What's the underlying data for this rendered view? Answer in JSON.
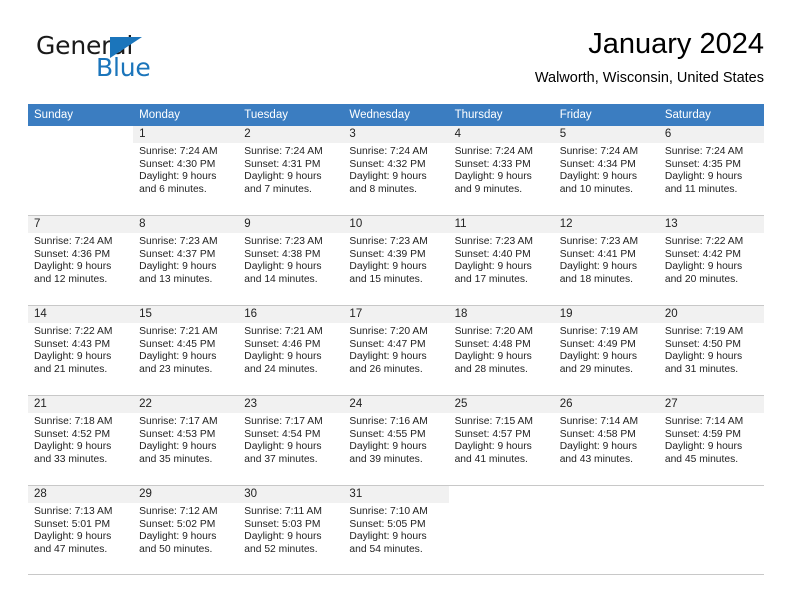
{
  "brand": {
    "name_top": "General",
    "name_bottom": "Blue",
    "accent_color": "#1b75bb"
  },
  "header": {
    "month_title": "January 2024",
    "location": "Walworth, Wisconsin, United States"
  },
  "calendar": {
    "header_color": "#3b7dc1",
    "weekday_headers": [
      "Sunday",
      "Monday",
      "Tuesday",
      "Wednesday",
      "Thursday",
      "Friday",
      "Saturday"
    ],
    "weeks": [
      [
        {
          "day": "",
          "sunrise": "",
          "sunset": "",
          "daylight_line1": "",
          "daylight_line2": ""
        },
        {
          "day": "1",
          "sunrise": "Sunrise: 7:24 AM",
          "sunset": "Sunset: 4:30 PM",
          "daylight_line1": "Daylight: 9 hours",
          "daylight_line2": "and 6 minutes."
        },
        {
          "day": "2",
          "sunrise": "Sunrise: 7:24 AM",
          "sunset": "Sunset: 4:31 PM",
          "daylight_line1": "Daylight: 9 hours",
          "daylight_line2": "and 7 minutes."
        },
        {
          "day": "3",
          "sunrise": "Sunrise: 7:24 AM",
          "sunset": "Sunset: 4:32 PM",
          "daylight_line1": "Daylight: 9 hours",
          "daylight_line2": "and 8 minutes."
        },
        {
          "day": "4",
          "sunrise": "Sunrise: 7:24 AM",
          "sunset": "Sunset: 4:33 PM",
          "daylight_line1": "Daylight: 9 hours",
          "daylight_line2": "and 9 minutes."
        },
        {
          "day": "5",
          "sunrise": "Sunrise: 7:24 AM",
          "sunset": "Sunset: 4:34 PM",
          "daylight_line1": "Daylight: 9 hours",
          "daylight_line2": "and 10 minutes."
        },
        {
          "day": "6",
          "sunrise": "Sunrise: 7:24 AM",
          "sunset": "Sunset: 4:35 PM",
          "daylight_line1": "Daylight: 9 hours",
          "daylight_line2": "and 11 minutes."
        }
      ],
      [
        {
          "day": "7",
          "sunrise": "Sunrise: 7:24 AM",
          "sunset": "Sunset: 4:36 PM",
          "daylight_line1": "Daylight: 9 hours",
          "daylight_line2": "and 12 minutes."
        },
        {
          "day": "8",
          "sunrise": "Sunrise: 7:23 AM",
          "sunset": "Sunset: 4:37 PM",
          "daylight_line1": "Daylight: 9 hours",
          "daylight_line2": "and 13 minutes."
        },
        {
          "day": "9",
          "sunrise": "Sunrise: 7:23 AM",
          "sunset": "Sunset: 4:38 PM",
          "daylight_line1": "Daylight: 9 hours",
          "daylight_line2": "and 14 minutes."
        },
        {
          "day": "10",
          "sunrise": "Sunrise: 7:23 AM",
          "sunset": "Sunset: 4:39 PM",
          "daylight_line1": "Daylight: 9 hours",
          "daylight_line2": "and 15 minutes."
        },
        {
          "day": "11",
          "sunrise": "Sunrise: 7:23 AM",
          "sunset": "Sunset: 4:40 PM",
          "daylight_line1": "Daylight: 9 hours",
          "daylight_line2": "and 17 minutes."
        },
        {
          "day": "12",
          "sunrise": "Sunrise: 7:23 AM",
          "sunset": "Sunset: 4:41 PM",
          "daylight_line1": "Daylight: 9 hours",
          "daylight_line2": "and 18 minutes."
        },
        {
          "day": "13",
          "sunrise": "Sunrise: 7:22 AM",
          "sunset": "Sunset: 4:42 PM",
          "daylight_line1": "Daylight: 9 hours",
          "daylight_line2": "and 20 minutes."
        }
      ],
      [
        {
          "day": "14",
          "sunrise": "Sunrise: 7:22 AM",
          "sunset": "Sunset: 4:43 PM",
          "daylight_line1": "Daylight: 9 hours",
          "daylight_line2": "and 21 minutes."
        },
        {
          "day": "15",
          "sunrise": "Sunrise: 7:21 AM",
          "sunset": "Sunset: 4:45 PM",
          "daylight_line1": "Daylight: 9 hours",
          "daylight_line2": "and 23 minutes."
        },
        {
          "day": "16",
          "sunrise": "Sunrise: 7:21 AM",
          "sunset": "Sunset: 4:46 PM",
          "daylight_line1": "Daylight: 9 hours",
          "daylight_line2": "and 24 minutes."
        },
        {
          "day": "17",
          "sunrise": "Sunrise: 7:20 AM",
          "sunset": "Sunset: 4:47 PM",
          "daylight_line1": "Daylight: 9 hours",
          "daylight_line2": "and 26 minutes."
        },
        {
          "day": "18",
          "sunrise": "Sunrise: 7:20 AM",
          "sunset": "Sunset: 4:48 PM",
          "daylight_line1": "Daylight: 9 hours",
          "daylight_line2": "and 28 minutes."
        },
        {
          "day": "19",
          "sunrise": "Sunrise: 7:19 AM",
          "sunset": "Sunset: 4:49 PM",
          "daylight_line1": "Daylight: 9 hours",
          "daylight_line2": "and 29 minutes."
        },
        {
          "day": "20",
          "sunrise": "Sunrise: 7:19 AM",
          "sunset": "Sunset: 4:50 PM",
          "daylight_line1": "Daylight: 9 hours",
          "daylight_line2": "and 31 minutes."
        }
      ],
      [
        {
          "day": "21",
          "sunrise": "Sunrise: 7:18 AM",
          "sunset": "Sunset: 4:52 PM",
          "daylight_line1": "Daylight: 9 hours",
          "daylight_line2": "and 33 minutes."
        },
        {
          "day": "22",
          "sunrise": "Sunrise: 7:17 AM",
          "sunset": "Sunset: 4:53 PM",
          "daylight_line1": "Daylight: 9 hours",
          "daylight_line2": "and 35 minutes."
        },
        {
          "day": "23",
          "sunrise": "Sunrise: 7:17 AM",
          "sunset": "Sunset: 4:54 PM",
          "daylight_line1": "Daylight: 9 hours",
          "daylight_line2": "and 37 minutes."
        },
        {
          "day": "24",
          "sunrise": "Sunrise: 7:16 AM",
          "sunset": "Sunset: 4:55 PM",
          "daylight_line1": "Daylight: 9 hours",
          "daylight_line2": "and 39 minutes."
        },
        {
          "day": "25",
          "sunrise": "Sunrise: 7:15 AM",
          "sunset": "Sunset: 4:57 PM",
          "daylight_line1": "Daylight: 9 hours",
          "daylight_line2": "and 41 minutes."
        },
        {
          "day": "26",
          "sunrise": "Sunrise: 7:14 AM",
          "sunset": "Sunset: 4:58 PM",
          "daylight_line1": "Daylight: 9 hours",
          "daylight_line2": "and 43 minutes."
        },
        {
          "day": "27",
          "sunrise": "Sunrise: 7:14 AM",
          "sunset": "Sunset: 4:59 PM",
          "daylight_line1": "Daylight: 9 hours",
          "daylight_line2": "and 45 minutes."
        }
      ],
      [
        {
          "day": "28",
          "sunrise": "Sunrise: 7:13 AM",
          "sunset": "Sunset: 5:01 PM",
          "daylight_line1": "Daylight: 9 hours",
          "daylight_line2": "and 47 minutes."
        },
        {
          "day": "29",
          "sunrise": "Sunrise: 7:12 AM",
          "sunset": "Sunset: 5:02 PM",
          "daylight_line1": "Daylight: 9 hours",
          "daylight_line2": "and 50 minutes."
        },
        {
          "day": "30",
          "sunrise": "Sunrise: 7:11 AM",
          "sunset": "Sunset: 5:03 PM",
          "daylight_line1": "Daylight: 9 hours",
          "daylight_line2": "and 52 minutes."
        },
        {
          "day": "31",
          "sunrise": "Sunrise: 7:10 AM",
          "sunset": "Sunset: 5:05 PM",
          "daylight_line1": "Daylight: 9 hours",
          "daylight_line2": "and 54 minutes."
        },
        {
          "day": "",
          "sunrise": "",
          "sunset": "",
          "daylight_line1": "",
          "daylight_line2": ""
        },
        {
          "day": "",
          "sunrise": "",
          "sunset": "",
          "daylight_line1": "",
          "daylight_line2": ""
        },
        {
          "day": "",
          "sunrise": "",
          "sunset": "",
          "daylight_line1": "",
          "daylight_line2": ""
        }
      ]
    ]
  }
}
